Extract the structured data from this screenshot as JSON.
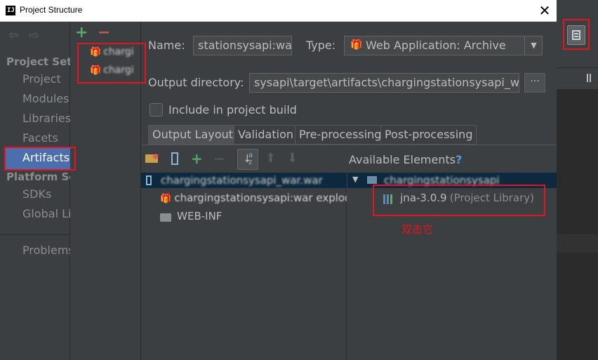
{
  "window": {
    "title": "Project Structure",
    "logo_text": "IJ",
    "close_glyph": "✕"
  },
  "nav": {
    "back_glyph": "⇦",
    "forward_glyph": "⇨",
    "section_project": "Project Set",
    "items_project": [
      "Project",
      "Modules",
      "Libraries",
      "Facets",
      "Artifacts"
    ],
    "section_platform": "Platform Se",
    "items_platform": [
      "SDKs",
      "Global Li"
    ],
    "problems": "Problems",
    "selected": "Artifacts"
  },
  "artifacts_list": {
    "add_glyph": "+",
    "remove_glyph": "−",
    "items": [
      "chargi",
      "chargi"
    ]
  },
  "form": {
    "name_label": "Name:",
    "name_value": "stationsysapi:war",
    "type_label": "Type:",
    "type_value": "Web Application: Archive",
    "output_dir_label": "Output directory:",
    "output_dir_value": "sysapi\\target\\artifacts\\chargingstationsysapi_war",
    "browse_label": "···",
    "include_label": "Include in project build",
    "include_checked": false
  },
  "tabs": [
    "Output Layout",
    "Validation",
    "Pre-processing",
    "Post-processing"
  ],
  "layout_tree": {
    "root": "chargingstationsysapi_war.war",
    "items": [
      {
        "label": "chargingstationsysapi:war exploded",
        "icon": "gift-icon"
      },
      {
        "label": "WEB-INF",
        "icon": "folder-icon"
      }
    ]
  },
  "available": {
    "header": "Available Elements",
    "help_glyph": "?",
    "root": "chargingstationsysapi",
    "library_name": "jna-3.0.9",
    "library_note": "(Project Library)"
  },
  "annotation": {
    "text": "双击它"
  },
  "colors": {
    "annotation_red": "#e8131e",
    "selection_blue": "#4b6eaf",
    "tree_selection": "#0d293e"
  }
}
